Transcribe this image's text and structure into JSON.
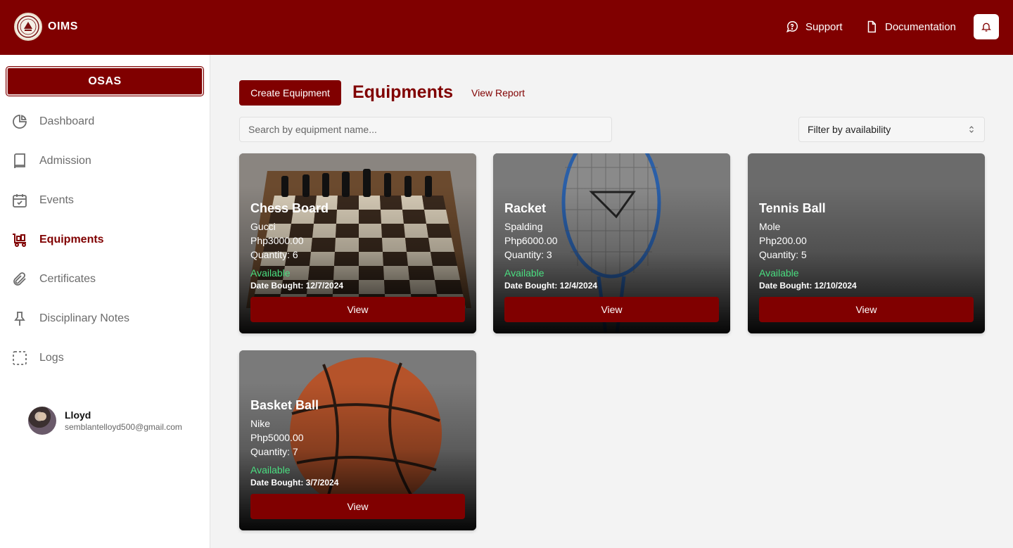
{
  "header": {
    "app_name": "OIMS",
    "support_label": "Support",
    "documentation_label": "Documentation"
  },
  "sidebar": {
    "org_label": "OSAS",
    "items": [
      {
        "label": "Dashboard",
        "icon": "pie-chart-icon"
      },
      {
        "label": "Admission",
        "icon": "book-icon"
      },
      {
        "label": "Events",
        "icon": "calendar-check-icon"
      },
      {
        "label": "Equipments",
        "icon": "cart-icon"
      },
      {
        "label": "Certificates",
        "icon": "paperclip-icon"
      },
      {
        "label": "Disciplinary Notes",
        "icon": "pin-icon"
      },
      {
        "label": "Logs",
        "icon": "dashed-square-icon"
      }
    ],
    "active_item": "Equipments",
    "user": {
      "name": "Lloyd",
      "email": "semblantelloyd500@gmail.com"
    }
  },
  "main": {
    "create_label": "Create Equipment",
    "title": "Equipments",
    "view_report_label": "View Report",
    "search_placeholder": "Search by equipment name...",
    "filter_label": "Filter by availability",
    "view_label": "View",
    "cards": [
      {
        "name": "Chess Board",
        "brand": "Gucci",
        "price": "Php3000.00",
        "quantity": "Quantity: 6",
        "status": "Available",
        "date": "Date Bought: 12/7/2024",
        "image": "chessboard"
      },
      {
        "name": "Racket",
        "brand": "Spalding",
        "price": "Php6000.00",
        "quantity": "Quantity: 3",
        "status": "Available",
        "date": "Date Bought: 12/4/2024",
        "image": "racket"
      },
      {
        "name": "Tennis Ball",
        "brand": "Mole",
        "price": "Php200.00",
        "quantity": "Quantity: 5",
        "status": "Available",
        "date": "Date Bought: 12/10/2024",
        "image": "none"
      },
      {
        "name": "Basket Ball",
        "brand": "Nike",
        "price": "Php5000.00",
        "quantity": "Quantity: 7",
        "status": "Available",
        "date": "Date Bought: 3/7/2024",
        "image": "basketball"
      }
    ]
  },
  "colors": {
    "brand": "#800000",
    "available": "#4ade80",
    "background": "#f3f3f3"
  }
}
